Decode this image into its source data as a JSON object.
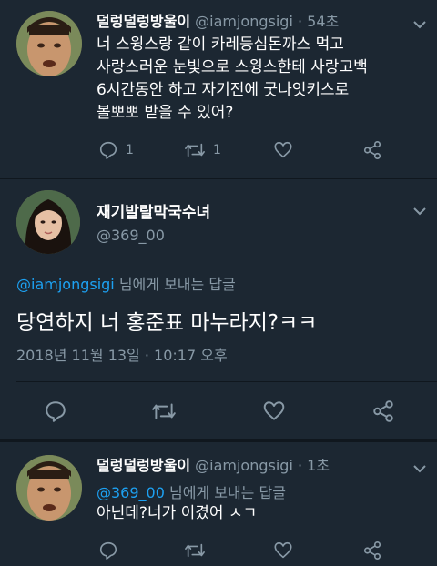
{
  "tweet1": {
    "name": "덜렁덜렁방울이",
    "handle": "@iamjongsigi",
    "time": "· 54초",
    "lines": [
      "너 스윙스랑 같이 카레등심돈까스 먹고",
      "사랑스러운 눈빛으로 스윙스한테 사랑고백",
      "6시간동안 하고 자기전에 굿나잇키스로",
      "볼뽀뽀 받을 수 있어?"
    ],
    "reply_count": "1",
    "retweet_count": "1"
  },
  "tweet2": {
    "name": "재기발랄막국수녀",
    "handle": "@369_00",
    "reply_to_handle": "@iamjongsigi",
    "reply_to_suffix": " 님에게 보내는 답글",
    "text": "당연하지 너 홍준표 마누라지?ㅋㅋ",
    "timestamp": "2018년 11월 13일 · 10:17 오후"
  },
  "tweet3": {
    "name": "덜렁덜렁방울이",
    "handle": "@iamjongsigi",
    "time": "· 1초",
    "reply_to_handle": "@369_00",
    "reply_to_suffix": " 님에게 보내는 답글",
    "text": "아닌데?너가 이겼어 ㅅㄱ"
  },
  "icons": {
    "reply": "reply-icon",
    "retweet": "retweet-icon",
    "like": "heart-icon",
    "share": "share-icon",
    "menu": "chevron-down-icon"
  },
  "colors": {
    "background": "#1c2732",
    "secondary_text": "#8899a6",
    "link": "#1da1f2"
  }
}
